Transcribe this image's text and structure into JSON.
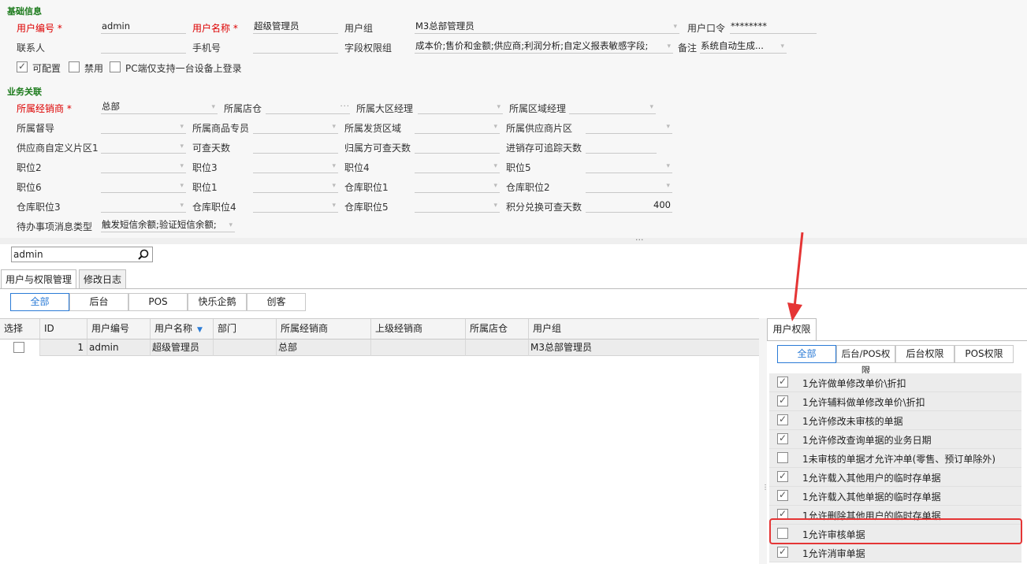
{
  "basic": {
    "title": "基础信息",
    "user_no_label": "用户编号",
    "user_no": "admin",
    "user_name_label": "用户名称",
    "user_name": "超级管理员",
    "group_label": "用户组",
    "group": "M3总部管理员",
    "password_label": "用户口令",
    "password": "********",
    "contact_label": "联系人",
    "contact": "",
    "phone_label": "手机号",
    "phone": "",
    "field_perm_label": "字段权限组",
    "field_perm": "成本价;售价和金额;供应商;利润分析;自定义报表敏感字段;",
    "remark_label": "备注",
    "remark": "系统自动生成...",
    "configurable_label": "可配置",
    "disabled_label": "禁用",
    "pc_single_label": "PC端仅支持一台设备上登录",
    "required_mark": "*"
  },
  "biz": {
    "title": "业务关联",
    "dealer_label": "所属经销商",
    "dealer": "总部",
    "store_label": "所属店仓",
    "store": "",
    "store_dots": "···",
    "region_mgr_label": "所属大区经理",
    "area_mgr_label": "所属区域经理",
    "supervisor_label": "所属督导",
    "goods_specialist_label": "所属商品专员",
    "ship_area_label": "所属发货区域",
    "supplier_area_label": "所属供应商片区",
    "supplier_custom_label": "供应商自定义片区1",
    "view_days_label": "可查天数",
    "owner_view_days_label": "归属方可查天数",
    "trace_days_label": "进销存可追踪天数",
    "pos2_label": "职位2",
    "pos3_label": "职位3",
    "pos4_label": "职位4",
    "pos5_label": "职位5",
    "pos6_label": "职位6",
    "pos1_label": "职位1",
    "wh_pos1_label": "仓库职位1",
    "wh_pos2_label": "仓库职位2",
    "wh_pos3_label": "仓库职位3",
    "wh_pos4_label": "仓库职位4",
    "wh_pos5_label": "仓库职位5",
    "points_days_label": "积分兑换可查天数",
    "points_days": "400",
    "todo_label": "待办事项消息类型",
    "todo": "触发短信余额;验证短信余额;"
  },
  "search": {
    "value": "admin"
  },
  "tabs": [
    "用户与权限管理",
    "修改日志"
  ],
  "filters": [
    "全部",
    "后台",
    "POS",
    "快乐企鹅",
    "创客"
  ],
  "table": {
    "headers": [
      "选择",
      "ID",
      "用户编号",
      "用户名称",
      "部门",
      "所属经销商",
      "上级经销商",
      "所属店仓",
      "用户组"
    ],
    "rows": [
      {
        "id": "1",
        "user_no": "admin",
        "user_name": "超级管理员",
        "dept": "",
        "dealer": "总部",
        "parent": "",
        "store": "",
        "group": "M3总部管理员"
      }
    ]
  },
  "right": {
    "tab": "用户权限",
    "filters": [
      "全部",
      "后台/POS权限",
      "后台权限",
      "POS权限"
    ],
    "perms": [
      {
        "label": "1允许做单修改单价\\折扣",
        "checked": true
      },
      {
        "label": "1允许辅料做单修改单价\\折扣",
        "checked": true
      },
      {
        "label": "1允许修改未审核的单据",
        "checked": true
      },
      {
        "label": "1允许修改查询单据的业务日期",
        "checked": true
      },
      {
        "label": "1未审核的单据才允许冲单(零售、预订单除外)",
        "checked": false
      },
      {
        "label": "1允许载入其他用户的临时存单据",
        "checked": true
      },
      {
        "label": "1允许载入其他单据的临时存单据",
        "checked": true
      },
      {
        "label": "1允许删除其他用户的临时存单据",
        "checked": true
      },
      {
        "label": "1允许审核单据",
        "checked": false
      },
      {
        "label": "1允许消审单据",
        "checked": true
      }
    ]
  },
  "colors": {
    "accent": "#2b7bd6",
    "section": "#1b7a1b",
    "required": "#dd0000",
    "highlight": "#e53535"
  }
}
